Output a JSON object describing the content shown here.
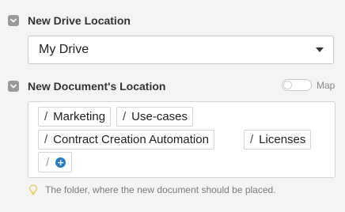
{
  "drive_section": {
    "title": "New Drive Location",
    "selected_value": "My Drive"
  },
  "document_section": {
    "title": "New Document's Location",
    "map_label": "Map",
    "path_segments": [
      "Marketing",
      "Use-cases",
      "Contract Creation Automation",
      "Licenses"
    ],
    "separator": "/",
    "add_symbol": "+",
    "hint": "The folder, where the new document should be placed."
  },
  "colors": {
    "background": "#f4f4f4",
    "toggle_box": "#9a9a9a",
    "add_button": "#2a7bbf",
    "hint_icon": "#e8c34a"
  },
  "icons": {
    "collapse": "chevron-down-icon",
    "select": "caret-down-icon",
    "add": "plus-circle-icon",
    "hint": "lightbulb-icon"
  }
}
